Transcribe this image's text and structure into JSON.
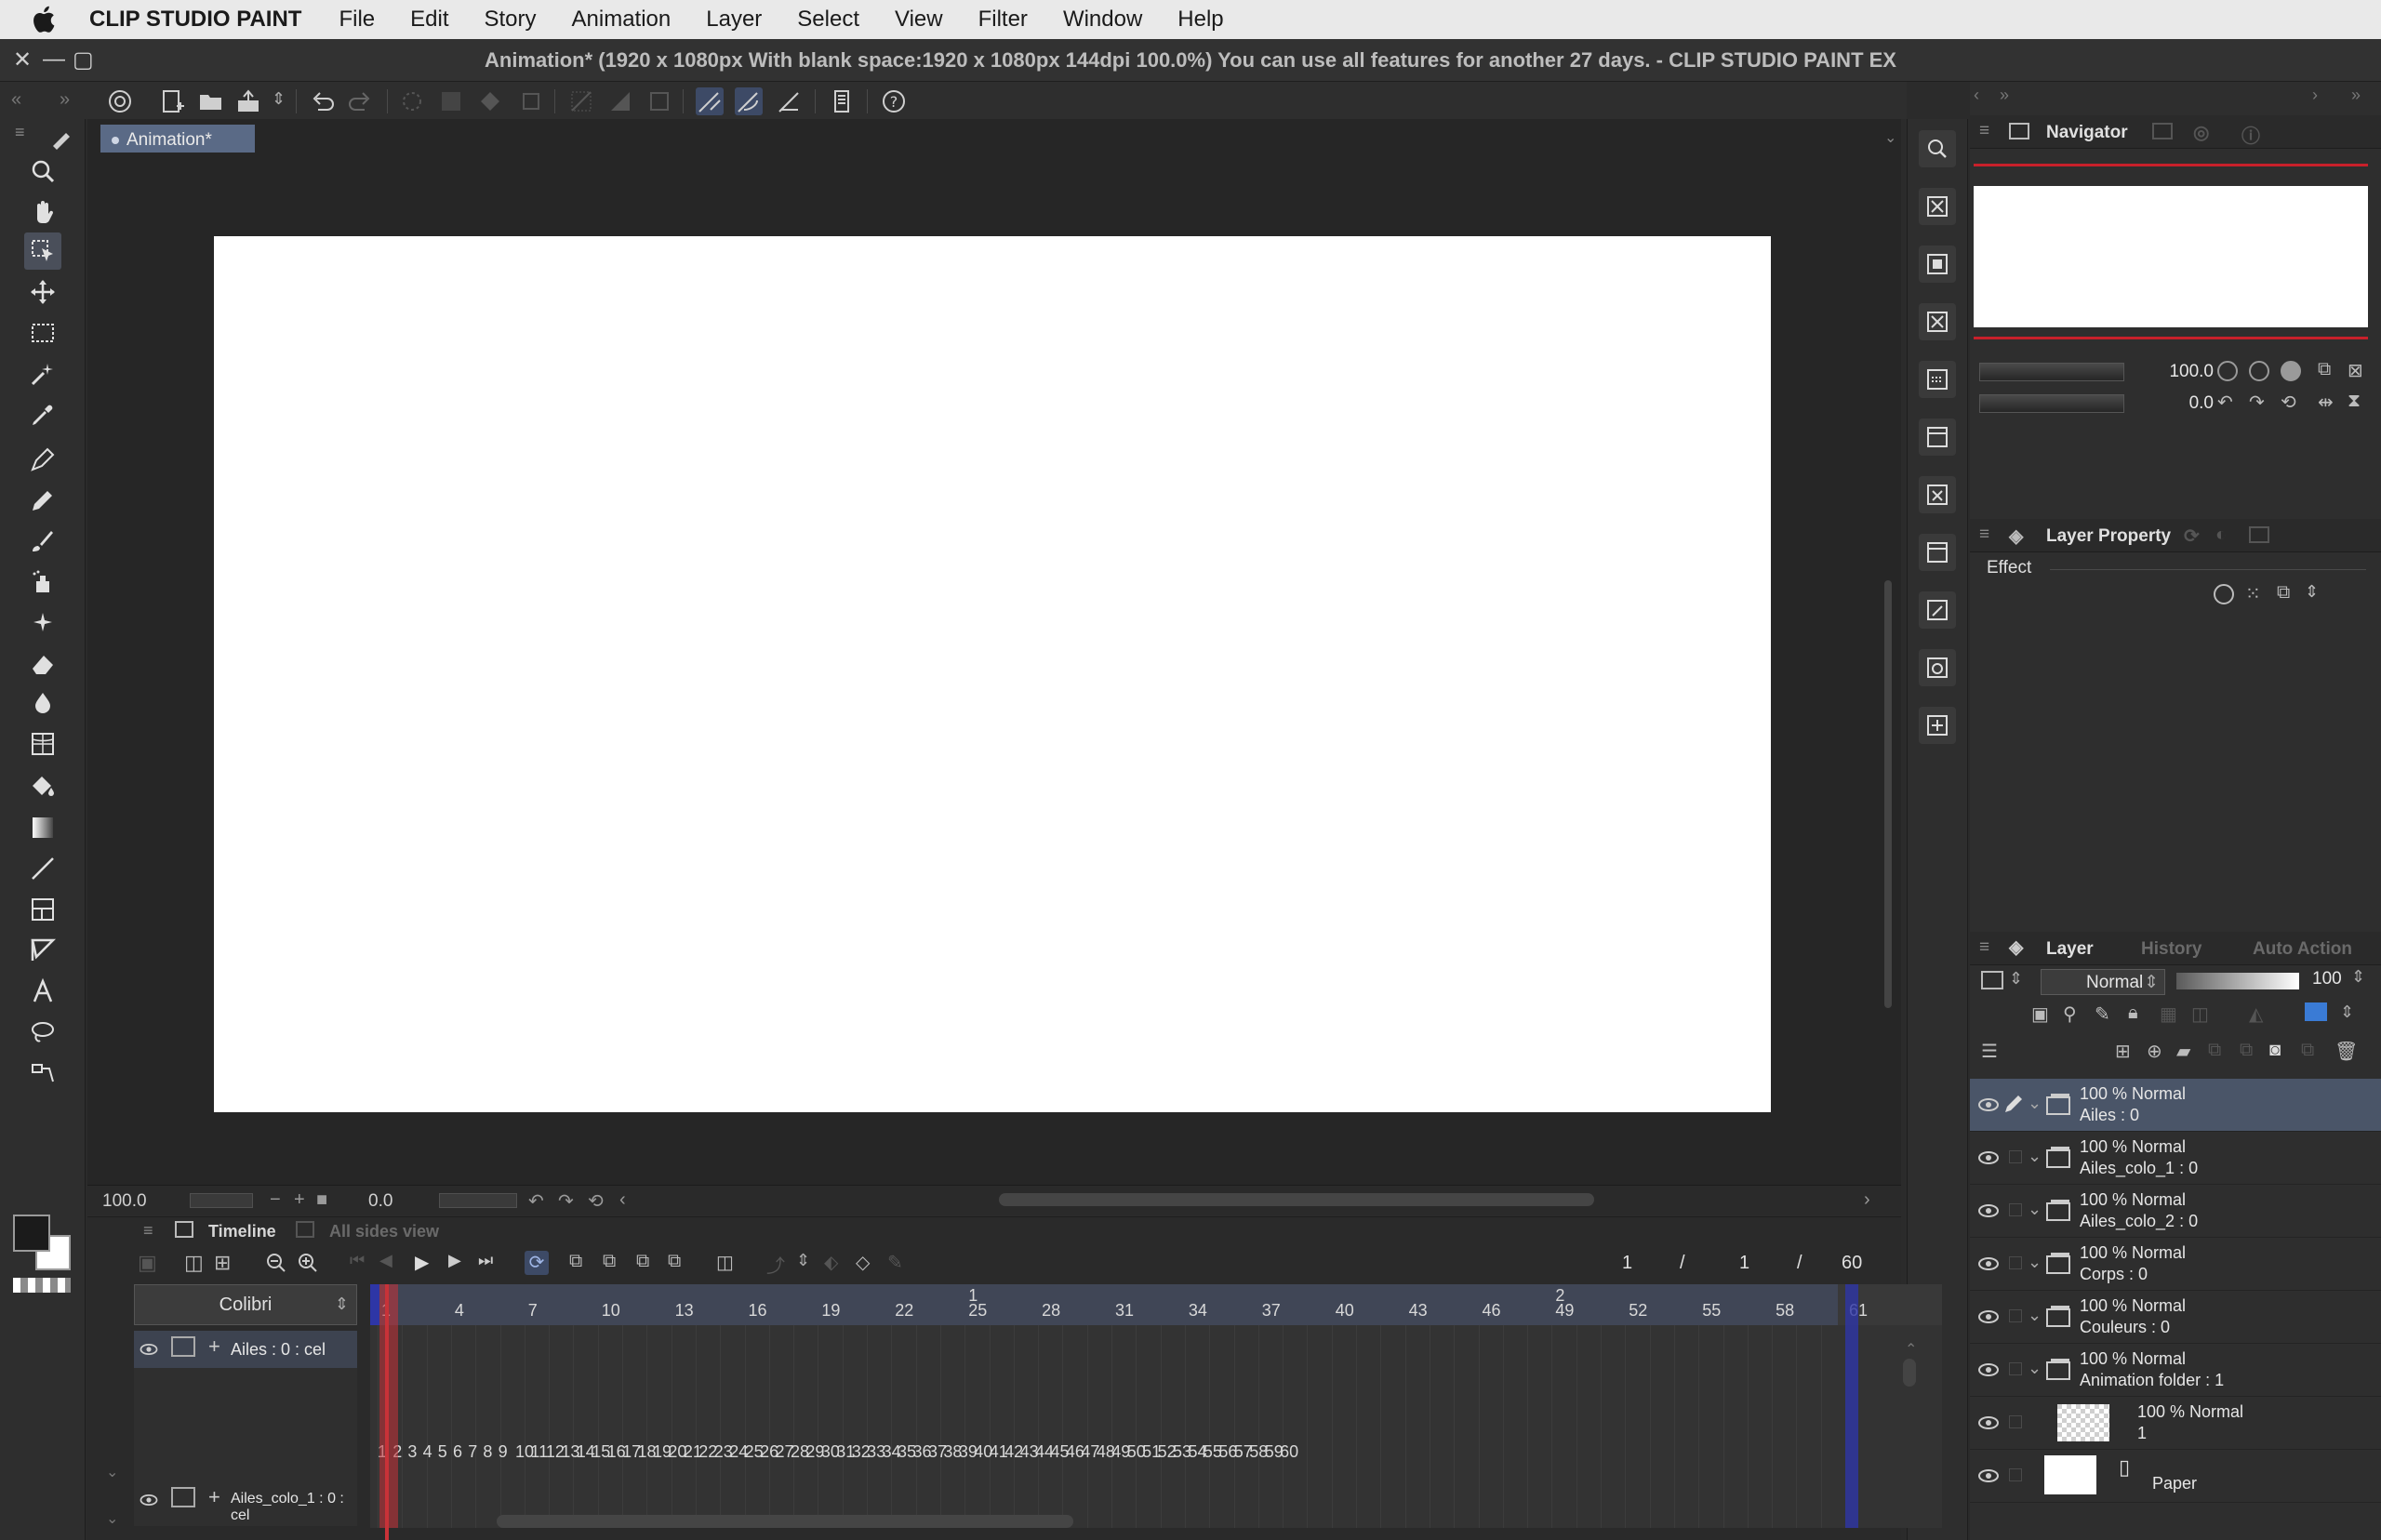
{
  "menubar": {
    "app_name": "CLIP STUDIO PAINT",
    "items": [
      "File",
      "Edit",
      "Story",
      "Animation",
      "Layer",
      "Select",
      "View",
      "Filter",
      "Window",
      "Help"
    ]
  },
  "window": {
    "title": "Animation* (1920 x 1080px With blank space:1920 x 1080px 144dpi 100.0%)  You can use all features for another 27 days. - CLIP STUDIO PAINT EX"
  },
  "canvas": {
    "tab_label": "Animation*",
    "zoom": "100.0",
    "rotation": "0.0"
  },
  "navigator": {
    "title": "Navigator",
    "zoom": "100.0",
    "rotation": "0.0"
  },
  "layer_property": {
    "title": "Layer Property",
    "effect_label": "Effect"
  },
  "layer_panel": {
    "tabs": [
      "Layer",
      "History",
      "Auto Action"
    ],
    "blend_mode": "Normal",
    "opacity": "100",
    "layers": [
      {
        "line1": "100 %  Normal",
        "line2": "Ailes : 0",
        "selected": true
      },
      {
        "line1": "100 %  Normal",
        "line2": "Ailes_colo_1 : 0"
      },
      {
        "line1": "100 %  Normal",
        "line2": "Ailes_colo_2 : 0"
      },
      {
        "line1": "100 %  Normal",
        "line2": "Corps : 0"
      },
      {
        "line1": "100 %  Normal",
        "line2": "Couleurs  : 0"
      },
      {
        "line1": "100 %  Normal",
        "line2": "Animation folder : 1"
      },
      {
        "line1": "100 %  Normal",
        "line2": "1"
      },
      {
        "line1": "",
        "line2": "Paper"
      }
    ]
  },
  "timeline": {
    "tabs": [
      "Timeline",
      "All sides view"
    ],
    "track_select": "Colibri",
    "frame_current": "1",
    "frame_sep1": "/",
    "frame_start": "1",
    "frame_sep2": "/",
    "frame_total": "60",
    "tracks": [
      "Ailes : 0 : cel",
      "Ailes_colo_1 : 0 : cel"
    ],
    "ruler_numbers": [
      "1",
      "4",
      "7",
      "10",
      "13",
      "16",
      "19",
      "22",
      "25",
      "28",
      "31",
      "34",
      "37",
      "40",
      "43",
      "46",
      "49",
      "52",
      "55",
      "58",
      "61"
    ],
    "scene_marks": [
      "1",
      "2"
    ],
    "cel_numbers": [
      "1",
      "2",
      "3",
      "4",
      "5",
      "6",
      "7",
      "8",
      "9",
      "10",
      "11",
      "12",
      "13",
      "14",
      "15",
      "16",
      "17",
      "18",
      "19",
      "20",
      "21",
      "22",
      "23",
      "24",
      "25",
      "26",
      "27",
      "28",
      "29",
      "30",
      "31",
      "32",
      "33",
      "34",
      "35",
      "36",
      "37",
      "38",
      "39",
      "40",
      "41",
      "42",
      "43",
      "44",
      "45",
      "46",
      "47",
      "48",
      "49",
      "50",
      "51",
      "52",
      "53",
      "54",
      "55",
      "56",
      "57",
      "58",
      "59",
      "60"
    ]
  },
  "colors": {
    "accent_selection": "#4a5568",
    "playhead": "#c83238",
    "marker_blue": "#2e36a6",
    "navigator_frame": "#c8202a"
  },
  "icons": {
    "tools": [
      "pen-nib-icon",
      "zoom-icon",
      "hand-icon",
      "object-select-icon",
      "move-icon",
      "rect-select-icon",
      "magic-wand-icon",
      "eyedropper-icon",
      "pen-icon",
      "pencil-icon",
      "brush-icon",
      "airbrush-icon",
      "decoration-icon",
      "eraser-icon",
      "blend-icon",
      "grid-icon",
      "fill-icon",
      "gradient-icon",
      "line-icon",
      "frame-icon",
      "ruler-icon",
      "text-icon",
      "lasso-icon",
      "correct-line-icon"
    ]
  }
}
